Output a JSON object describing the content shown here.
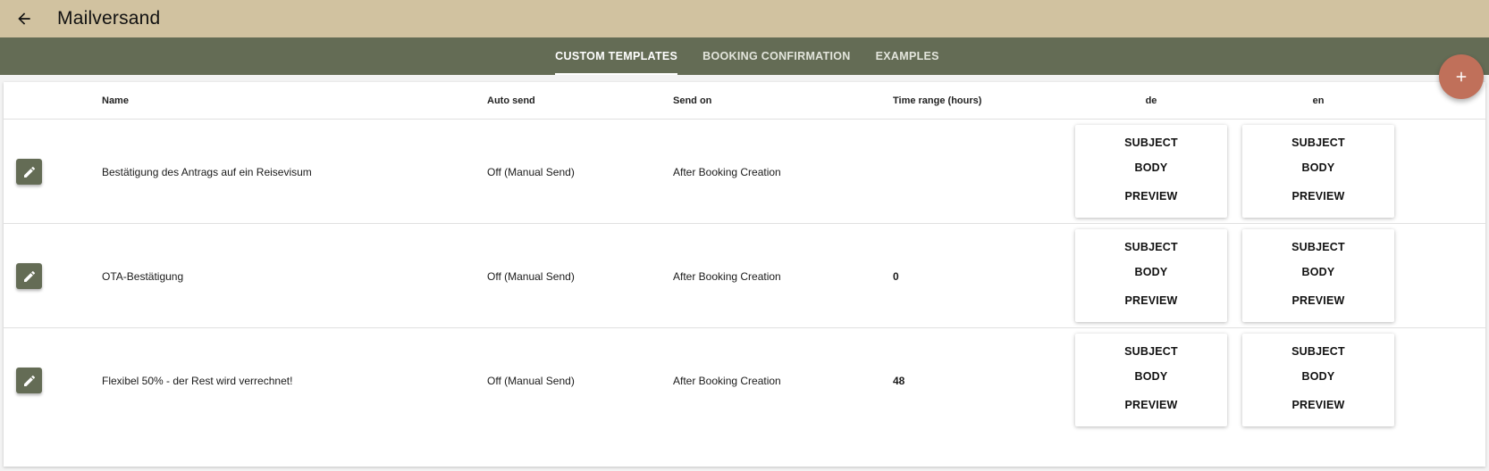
{
  "header": {
    "title": "Mailversand"
  },
  "tabs": [
    {
      "label": "CUSTOM TEMPLATES",
      "active": true
    },
    {
      "label": "BOOKING CONFIRMATION",
      "active": false
    },
    {
      "label": "EXAMPLES",
      "active": false
    }
  ],
  "table": {
    "columns": {
      "name": "Name",
      "auto_send": "Auto send",
      "send_on": "Send on",
      "time_range": "Time range (hours)",
      "lang_de": "de",
      "lang_en": "en"
    },
    "actions": {
      "subject": "SUBJECT",
      "body": "BODY",
      "preview": "PREVIEW"
    },
    "rows": [
      {
        "name": "Bestätigung des Antrags auf ein Reisevisum",
        "auto_send": "Off (Manual Send)",
        "send_on": "After Booking Creation",
        "time_range": ""
      },
      {
        "name": "OTA-Bestätigung",
        "auto_send": "Off (Manual Send)",
        "send_on": "After Booking Creation",
        "time_range": "0"
      },
      {
        "name": "Flexibel 50% - der Rest wird verrechnet!",
        "auto_send": "Off (Manual Send)",
        "send_on": "After Booking Creation",
        "time_range": "48"
      }
    ]
  },
  "icons": {
    "back": "arrow-left-icon",
    "add": "plus-icon",
    "edit": "pencil-icon"
  },
  "colors": {
    "topbar": "#d1c2a0",
    "tabbar": "#646c55",
    "fab": "#c0705a",
    "edit_button": "#646c55"
  }
}
